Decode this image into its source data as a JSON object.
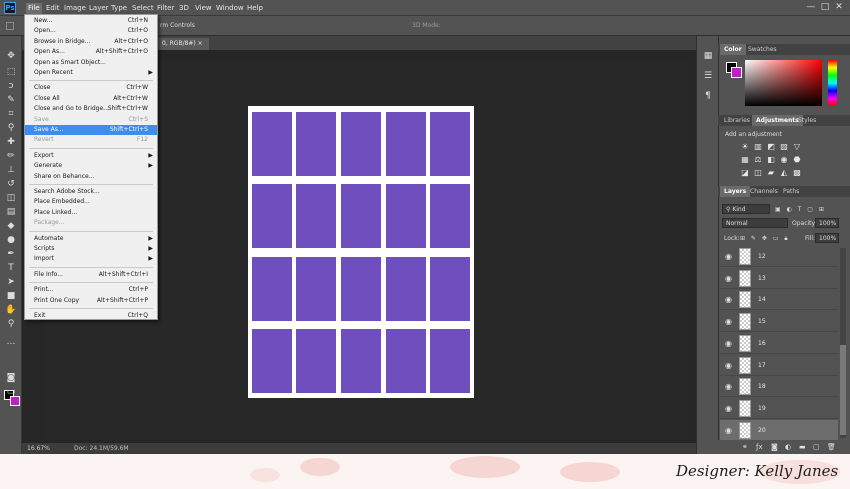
{
  "app": {
    "menus": [
      "File",
      "Edit",
      "Image",
      "Layer",
      "Type",
      "Select",
      "Filter",
      "3D",
      "View",
      "Window",
      "Help"
    ],
    "window_controls": [
      "—",
      "□",
      "✕"
    ]
  },
  "options_bar": {
    "text": "rm Controls",
    "mode_3d": "3D Mode:"
  },
  "document": {
    "tab": "0, RGB/8#) ×",
    "zoom": "16.67%",
    "doc_size": "Doc: 24.1M/59.6M",
    "fill_color": "#6e4fbd",
    "grid_rows": 4,
    "grid_cols": 5
  },
  "file_menu": {
    "items": [
      {
        "label": "New...",
        "shortcut": "Ctrl+N"
      },
      {
        "label": "Open...",
        "shortcut": "Ctrl+O"
      },
      {
        "label": "Browse in Bridge...",
        "shortcut": "Alt+Ctrl+O"
      },
      {
        "label": "Open As...",
        "shortcut": "Alt+Shift+Ctrl+O"
      },
      {
        "label": "Open as Smart Object...",
        "shortcut": ""
      },
      {
        "label": "Open Recent",
        "shortcut": "",
        "submenu": true
      },
      {
        "sep": true
      },
      {
        "label": "Close",
        "shortcut": "Ctrl+W"
      },
      {
        "label": "Close All",
        "shortcut": "Alt+Ctrl+W"
      },
      {
        "label": "Close and Go to Bridge...",
        "shortcut": "Shift+Ctrl+W"
      },
      {
        "label": "Save",
        "shortcut": "Ctrl+S",
        "disabled": true
      },
      {
        "label": "Save As...",
        "shortcut": "Shift+Ctrl+S",
        "highlight": true
      },
      {
        "label": "Revert",
        "shortcut": "F12",
        "disabled": true
      },
      {
        "sep": true
      },
      {
        "label": "Export",
        "shortcut": "",
        "submenu": true
      },
      {
        "label": "Generate",
        "shortcut": "",
        "submenu": true
      },
      {
        "label": "Share on Behance...",
        "shortcut": ""
      },
      {
        "sep": true
      },
      {
        "label": "Search Adobe Stock...",
        "shortcut": ""
      },
      {
        "label": "Place Embedded...",
        "shortcut": ""
      },
      {
        "label": "Place Linked...",
        "shortcut": ""
      },
      {
        "label": "Package...",
        "shortcut": "",
        "disabled": true
      },
      {
        "sep": true
      },
      {
        "label": "Automate",
        "shortcut": "",
        "submenu": true
      },
      {
        "label": "Scripts",
        "shortcut": "",
        "submenu": true
      },
      {
        "label": "Import",
        "shortcut": "",
        "submenu": true
      },
      {
        "sep": true
      },
      {
        "label": "File Info...",
        "shortcut": "Alt+Shift+Ctrl+I"
      },
      {
        "sep": true
      },
      {
        "label": "Print...",
        "shortcut": "Ctrl+P"
      },
      {
        "label": "Print One Copy",
        "shortcut": "Alt+Shift+Ctrl+P"
      },
      {
        "sep": true
      },
      {
        "label": "Exit",
        "shortcut": "Ctrl+Q"
      }
    ]
  },
  "panels": {
    "color_tabs": [
      "Color",
      "Swatches"
    ],
    "adj_tabs": [
      "Libraries",
      "Adjustments",
      "Styles"
    ],
    "adj_heading": "Add an adjustment",
    "layer_tabs": [
      "Layers",
      "Channels",
      "Paths"
    ],
    "filter_kind": "Kind",
    "blend_mode": "Normal",
    "opacity_label": "Opacity:",
    "opacity_value": "100%",
    "lock_label": "Lock:",
    "fill_label": "Fill:",
    "fill_value": "100%",
    "fg_color": "#000000",
    "bg_color": "#c11ec8"
  },
  "layers": [
    "12",
    "13",
    "14",
    "15",
    "16",
    "17",
    "18",
    "19",
    "20"
  ],
  "selected_layer": "20",
  "banner": {
    "designer": "Designer: Kelly Janes"
  }
}
